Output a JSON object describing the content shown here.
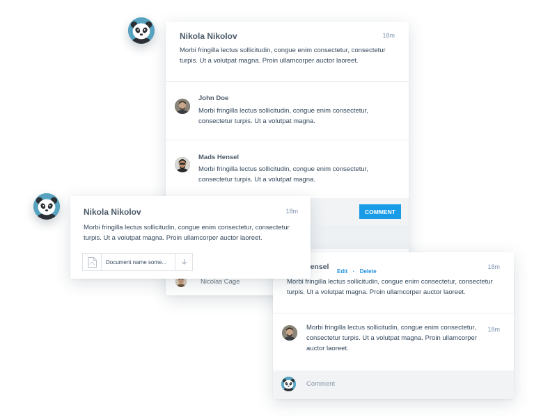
{
  "thread_top": {
    "main": {
      "author": "Nikola Nikolov",
      "time": "18m",
      "text": "Morbi fringilla lectus sollicitudin, congue enim consectetur, consectetur turpis. Ut a volutpat magna. Proin ullamcorper auctor laoreet."
    },
    "replies": [
      {
        "author": "John Doe",
        "text": "Morbi fringilla lectus sollicitudin, congue enim consectetur, consectetur turpis. Ut a volutpat magna."
      },
      {
        "author": "Mads Hensel",
        "text": "Morbi fringilla lectus sollicitudin, congue enim consectetur, consectetur turpis. Ut a volutpat magna."
      }
    ],
    "comment_button": "COMMENT",
    "user_list": [
      {
        "name": "Nicolas Cage"
      }
    ]
  },
  "thread_middle": {
    "author": "Nikola Nikolov",
    "time": "18m",
    "text": "Morbi fringilla lectus sollicitudin, congue enim consectetur, consectetur turpis. Ut a volutpat magna. Proin ullamcorper auctor laoreet.",
    "attachment": {
      "name": "Document name some...",
      "icon": "pdf-file-icon"
    }
  },
  "thread_bottom": {
    "header": {
      "author_partial": "Hensel",
      "edit_label": "Edit",
      "separator": "·",
      "delete_label": "Delete",
      "time": "18m",
      "text": "Morbi fringilla lectus sollicitudin, congue enim consectetur, consectetur turpis. Ut a volutpat magna. Proin ullamcorper auctor laoreet."
    },
    "reply": {
      "text": "Morbi fringilla lectus sollicitudin, congue enim consectetur, consectetur turpis. Ut a volutpat magna. Proin ullamcorper auctor laoreet.",
      "time": "18m"
    },
    "comment_placeholder": "Comment"
  },
  "colors": {
    "accent": "#1a9be8",
    "link": "#1f8fe0",
    "panda_bg": "#57a3bf",
    "footer_bg": "#f1f3f5"
  }
}
